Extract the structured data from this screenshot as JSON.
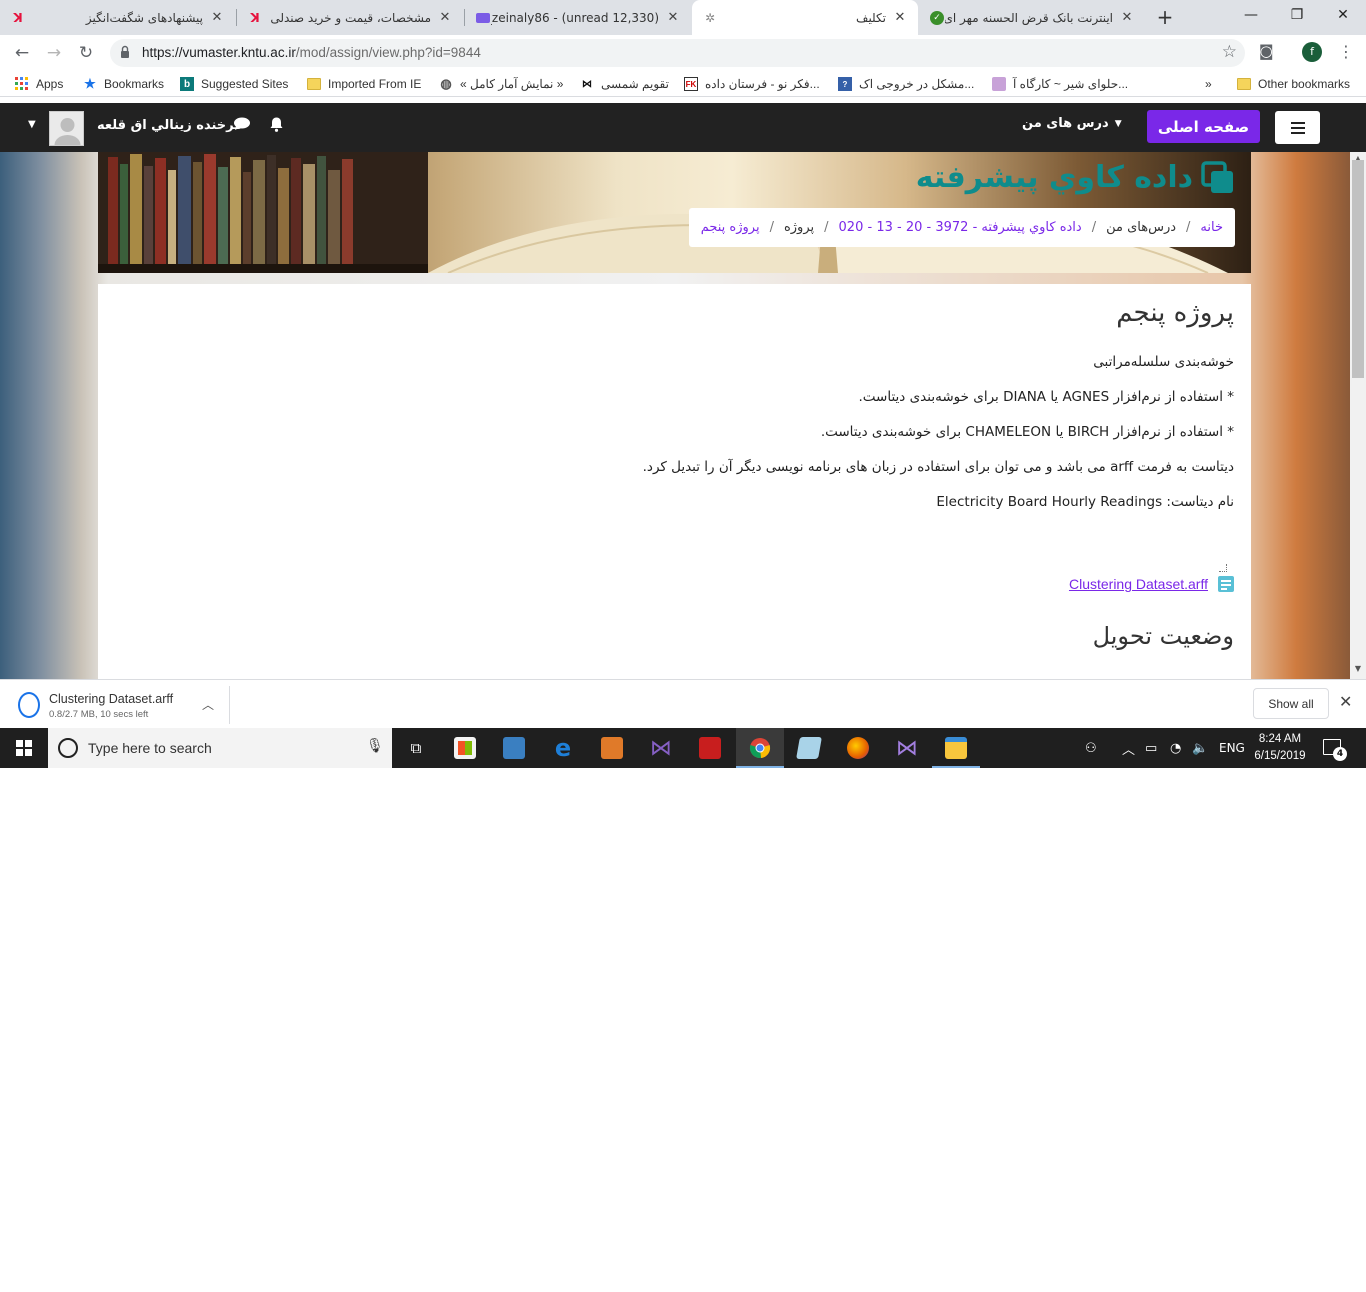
{
  "browser": {
    "tabs": [
      {
        "title": "پیشنهادهای شگفت‌انگیز",
        "favicon": "digikala-icon"
      },
      {
        "title": "مشخصات، قیمت و خرید صندلی",
        "favicon": "digikala-icon"
      },
      {
        "title": "(12,330 unread) - f_zeinaly86@",
        "favicon": "yahoo-mail-icon"
      },
      {
        "title": "تکلیف",
        "favicon": "moodle-icon"
      },
      {
        "title": "اینترنت بانک قرض الحسنه مهر ای",
        "favicon": "bank-icon"
      }
    ],
    "active_tab": 3,
    "url_host": "https://vumaster.kntu.ac.ir",
    "url_path": "/mod/assign/view.php?id=9844",
    "profile_initial": "f",
    "bookmarks": [
      "Apps",
      "Bookmarks",
      "Suggested Sites",
      "Imported From IE",
      "« نمایش آمار کامل »",
      "تقویم شمسی",
      "فکر نو - فرستان داده...",
      "مشکل در خروجی اک...",
      "حلوای شیر ~ کارگاه آ...",
      "»",
      "Other bookmarks"
    ]
  },
  "moodle": {
    "home_button": "صفحه اصلی",
    "my_courses": "درس های من",
    "user_name": "فرخنده زينالي اق قلعه"
  },
  "course": {
    "title": "داده كاوي پيشرفته",
    "breadcrumb": [
      {
        "label": "خانه",
        "link": true
      },
      {
        "label": "درس‌های من",
        "link": false
      },
      {
        "label": "داده كاوي پيشرفته - 3972 - 20 - 13 - 020",
        "link": true
      },
      {
        "label": "پروژه",
        "link": false
      },
      {
        "label": "پروژه پنجم",
        "link": true
      }
    ]
  },
  "assignment": {
    "heading": "پروژه پنجم",
    "lines": [
      "خوشه‌بندی سلسله‌مراتبی",
      "* استفاده از نرم‌افزار AGNES یا DIANA برای خوشه‌بندی دیتاست.",
      "* استفاده از نرم‌افزار BIRCH یا CHAMELEON برای خوشه‌بندی دیتاست.",
      "دیتاست به فرمت arff  می باشد و می توان برای استفاده در زبان های برنامه نویسی دیگر آن را تبدیل کرد.",
      "نام دیتاست: Electricity Board Hourly Readings "
    ],
    "file_name": "Clustering Dataset.arff",
    "status_heading": "وضعیت تحویل"
  },
  "download_bar": {
    "file_name": "Clustering Dataset.arff",
    "status": "0.8/2.7 MB, 10 secs left",
    "show_all": "Show all"
  },
  "taskbar": {
    "search_placeholder": "Type here to search",
    "language": "ENG",
    "time": "8:24 AM",
    "date": "6/15/2019",
    "notification_count": "4"
  }
}
